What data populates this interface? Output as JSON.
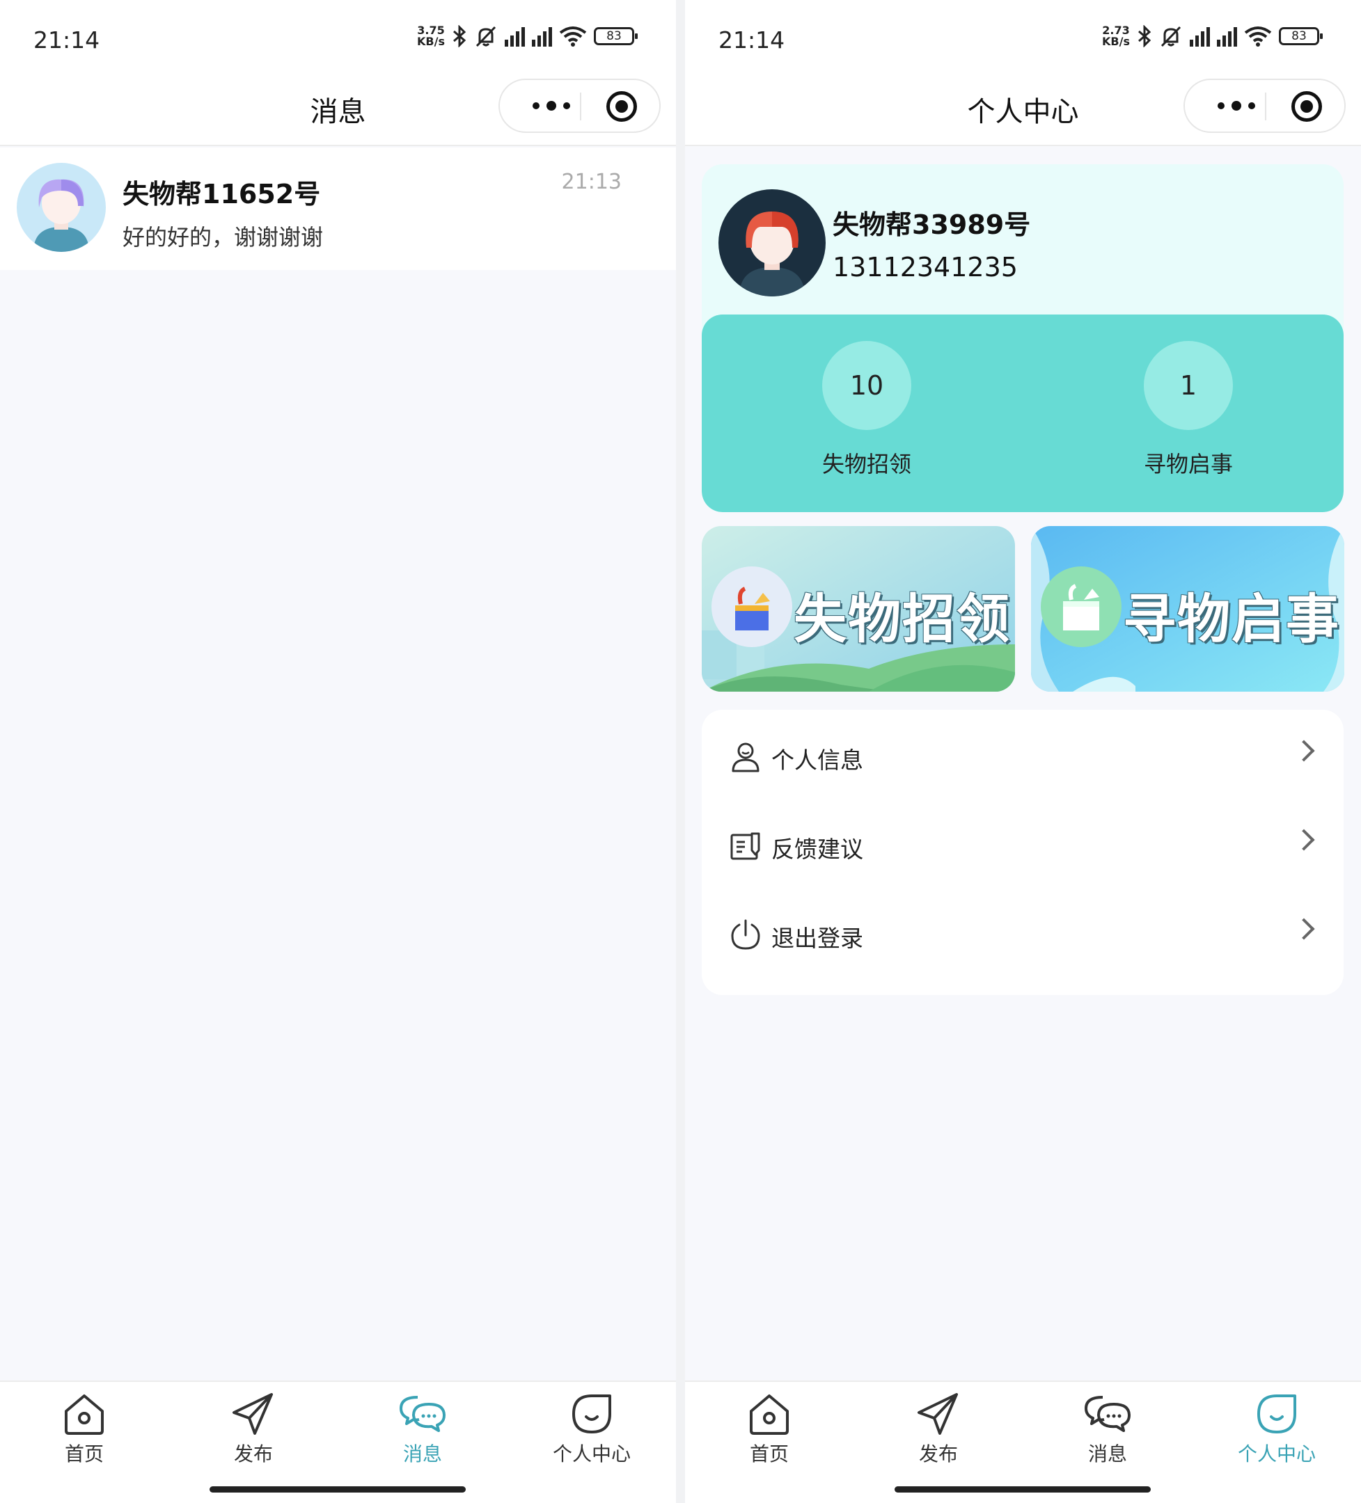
{
  "left_screen": {
    "status": {
      "time": "21:14",
      "speed_value": "3.75",
      "speed_unit": "KB/s",
      "battery": "83"
    },
    "nav": {
      "title": "消息"
    },
    "conversation": {
      "name": "失物帮11652号",
      "preview": "好的好的，谢谢谢谢",
      "time": "21:13"
    },
    "tabbar": {
      "active": "消息",
      "items": [
        {
          "label": "首页",
          "icon": "home-icon"
        },
        {
          "label": "发布",
          "icon": "paper-plane-icon"
        },
        {
          "label": "消息",
          "icon": "chat-bubbles-icon"
        },
        {
          "label": "个人中心",
          "icon": "smile-profile-icon"
        }
      ]
    }
  },
  "right_screen": {
    "status": {
      "time": "21:14",
      "speed_value": "2.73",
      "speed_unit": "KB/s",
      "battery": "83"
    },
    "nav": {
      "title": "个人中心"
    },
    "profile": {
      "name": "失物帮33989号",
      "phone": "13112341235"
    },
    "stats": [
      {
        "value": "10",
        "label": "失物招领"
      },
      {
        "value": "1",
        "label": "寻物启事"
      }
    ],
    "banners": [
      {
        "text": "失物招领",
        "icon": "lost-box-icon"
      },
      {
        "text": "寻物启事",
        "icon": "search-box-icon"
      }
    ],
    "menu": [
      {
        "label": "个人信息",
        "icon": "user-icon"
      },
      {
        "label": "反馈建议",
        "icon": "feedback-icon"
      },
      {
        "label": "退出登录",
        "icon": "power-icon"
      }
    ],
    "tabbar": {
      "active": "个人中心",
      "items": [
        {
          "label": "首页",
          "icon": "home-icon"
        },
        {
          "label": "发布",
          "icon": "paper-plane-icon"
        },
        {
          "label": "消息",
          "icon": "chat-bubbles-icon"
        },
        {
          "label": "个人中心",
          "icon": "smile-profile-icon"
        }
      ]
    }
  },
  "colors": {
    "accent": "#3aa3b5",
    "stats_panel": "#67dbd4",
    "stat_circle": "#96ebe4",
    "profile_card": "#e8fcfb",
    "page_bg": "#f7f8fc"
  }
}
